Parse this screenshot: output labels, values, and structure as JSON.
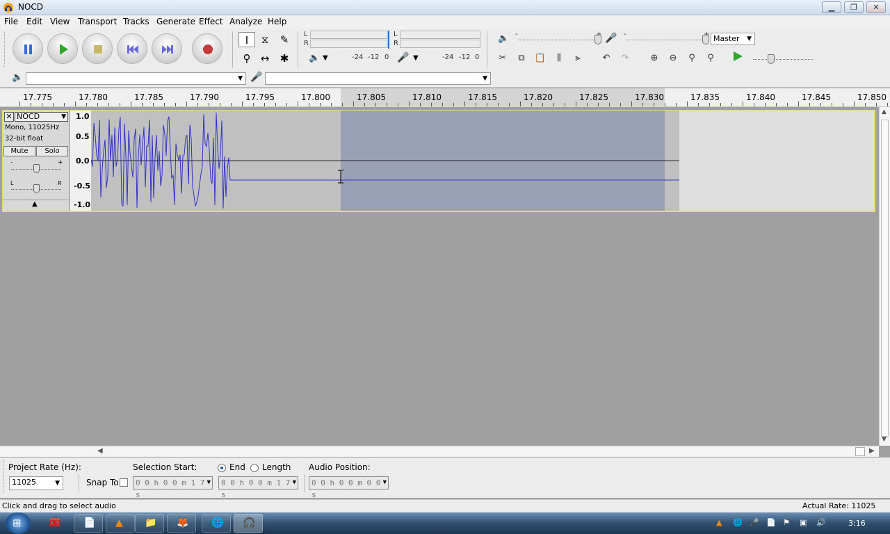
{
  "window": {
    "title": "NOCD"
  },
  "menu": [
    "File",
    "Edit",
    "View",
    "Transport",
    "Tracks",
    "Generate",
    "Effect",
    "Analyze",
    "Help"
  ],
  "meters": {
    "play": {
      "L": "L",
      "R": "R",
      "scale": [
        "-24",
        "-12",
        "0"
      ]
    },
    "record": {
      "L": "L",
      "R": "R",
      "scale": [
        "-24",
        "-12",
        "0"
      ]
    }
  },
  "mixer": {
    "master": "Master",
    "minus1": "-",
    "plus1": "+",
    "minus2": "-",
    "plus2": "+"
  },
  "ruler": [
    "17.775",
    "17.780",
    "17.785",
    "17.790",
    "17.795",
    "17.800",
    "17.805",
    "17.810",
    "17.815",
    "17.820",
    "17.825",
    "17.830",
    "17.835",
    "17.840",
    "17.845",
    "17.850"
  ],
  "track": {
    "name": "NOCD",
    "info1": "Mono, 11025Hz",
    "info2": "32-bit float",
    "mute": "Mute",
    "solo": "Solo",
    "gain_minus": "-",
    "gain_plus": "+",
    "pan_left": "L",
    "pan_right": "R",
    "scale": [
      "1.0",
      "0.5",
      "0.0",
      "-0.5",
      "-1.0"
    ]
  },
  "selection_bar": {
    "project_rate_label": "Project Rate (Hz):",
    "project_rate": "11025",
    "snap_to": "Snap To",
    "selection_start_label": "Selection Start:",
    "end_label": "End",
    "length_label": "Length",
    "audio_position_label": "Audio Position:",
    "selection_start": "0 0 h 0 0 m 1 7 s",
    "selection_end": "0 0 h 0 0 m 1 7 s",
    "audio_position": "0 0 h 0 0 m 0 0 s"
  },
  "status": {
    "hint": "Click and drag to select audio",
    "actual_rate": "Actual Rate: 11025"
  },
  "taskbar": {
    "clock": "3:16"
  },
  "colors": {
    "selection": "#9aa0b5",
    "waveform": "#3232c8",
    "track_border": "#e5dc6c",
    "play_green": "#2ea82e",
    "record_red": "#c23a3a"
  }
}
